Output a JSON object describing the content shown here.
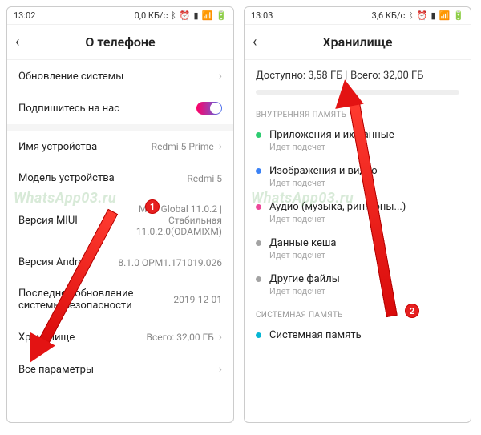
{
  "left": {
    "status": {
      "time": "13:02",
      "net": "0,0 КБ/с"
    },
    "title": "О телефоне",
    "rows": {
      "update": "Обновление системы",
      "subscribe": "Подпишитесь на нас",
      "device_name": {
        "label": "Имя устройства",
        "value": "Redmi 5 Prime"
      },
      "model": {
        "label": "Модель устройства",
        "value": "Redmi 5"
      },
      "miui": {
        "label": "Версия MIUI",
        "value": "MIUI Global 11.0.2 | Стабильная 11.0.2.0(ODAMIXM)"
      },
      "android": {
        "label": "Версия Android",
        "value": "8.1.0 OPM1.171019.026"
      },
      "security": {
        "label": "Последнее обновление системы безопасности",
        "value": "2019-12-01"
      },
      "storage": {
        "label": "Хранилище",
        "value": "Всего: 32,00 ГБ"
      },
      "all": "Все параметры"
    },
    "badge": "1"
  },
  "right": {
    "status": {
      "time": "13:03",
      "net": "3,6 КБ/с"
    },
    "title": "Хранилище",
    "available": {
      "label": "Доступно:",
      "value": "3,58 ГБ",
      "total_label": "Всего:",
      "total_value": "32,00 ГБ"
    },
    "section_internal": "ВНУТРЕННЯЯ ПАМЯТЬ",
    "items": [
      {
        "dot": "#2ecc71",
        "label": "Приложения и их данные",
        "sub": "Идет подсчет"
      },
      {
        "dot": "#3b82f6",
        "label": "Изображения и видео",
        "sub": "Идет подсчет"
      },
      {
        "dot": "#ec4899",
        "label": "Аудио (музыка, рингтоны...)",
        "sub": "Идет подсчет"
      },
      {
        "dot": "#a3a3a3",
        "label": "Данные кеша",
        "sub": "Идет подсчет"
      },
      {
        "dot": "#a3a3a3",
        "label": "Другие файлы",
        "sub": "Идет подсчет"
      }
    ],
    "section_sys": "СИСТЕМНАЯ ПАМЯТЬ",
    "sys_row": {
      "dot": "#06b6d4",
      "label": "Системная память"
    },
    "badge": "2"
  },
  "watermark": "WhatsApp03.ru",
  "icons": {
    "bt": "ᛒ",
    "alarm": "⏰",
    "sig": "▮",
    "wifi": "📶",
    "batt": "🔋"
  }
}
